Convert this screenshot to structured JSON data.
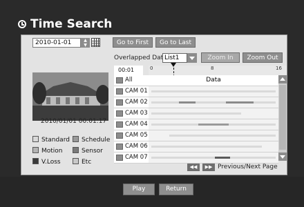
{
  "window": {
    "title": "Time Search"
  },
  "date": {
    "value": "2010-01-01"
  },
  "buttons": {
    "go_first": "Go to First",
    "go_last": "Go to Last",
    "zoom_in": "Zoom In",
    "zoom_out": "Zoom Out",
    "play": "Play",
    "return": "Return"
  },
  "overlap": {
    "label": "Overlapped Data",
    "selected": "List1"
  },
  "preview": {
    "timestamp": "2010/01/01  00:01:17"
  },
  "timeline": {
    "current_time": "00:01",
    "ticks": [
      "0",
      "8",
      "16"
    ],
    "data_header": "Data",
    "cursor_hour": 0.1
  },
  "cameras": [
    {
      "label": "All"
    },
    {
      "label": "CAM 01"
    },
    {
      "label": "CAM 02"
    },
    {
      "label": "CAM 03"
    },
    {
      "label": "CAM 04"
    },
    {
      "label": "CAM 05"
    },
    {
      "label": "CAM 06"
    },
    {
      "label": "CAM 07"
    }
  ],
  "legend": [
    {
      "label": "Standard",
      "color": "#d8d8d8"
    },
    {
      "label": "Schedule",
      "color": "#9a9a9a"
    },
    {
      "label": "Motion",
      "color": "#b4b4b4"
    },
    {
      "label": "Sensor",
      "color": "#7a7a7a"
    },
    {
      "label": "V.Loss",
      "color": "#3a3a3a"
    },
    {
      "label": "Etc",
      "color": "#c8c8c8"
    }
  ],
  "pager": {
    "label": "Previous/Next Page",
    "prev_icon": "rewind-icon",
    "next_icon": "fast-forward-icon"
  },
  "colors": {
    "panel": "#e3e3e3",
    "background": "#2a2a2a",
    "button": "#8e8e8e"
  }
}
